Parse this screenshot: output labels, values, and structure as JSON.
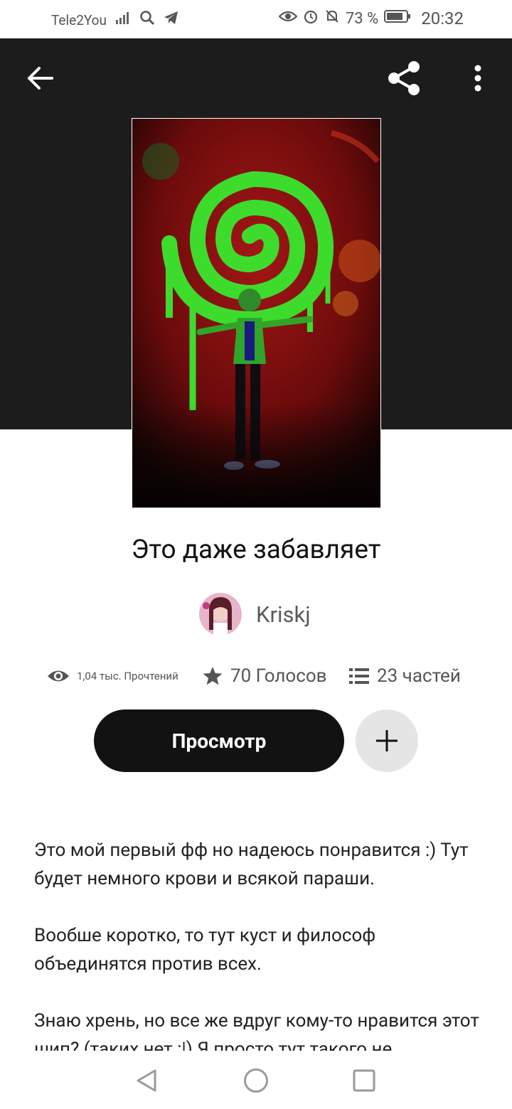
{
  "status_bar": {
    "carrier": "Tele2You",
    "battery": "73 %",
    "time": "20:32",
    "icons": [
      "signal-icon",
      "search-icon",
      "telegram-icon",
      "eye-icon",
      "alarm-icon",
      "bell-off-icon",
      "battery-icon"
    ]
  },
  "story": {
    "title": "Это даже забавляет",
    "author": "Kriskj",
    "reads": "1,04 тыс. Прочтений",
    "votes": "70 Голосов",
    "parts": "23 частей"
  },
  "actions": {
    "read_label": "Просмотр",
    "add_icon": "plus-icon"
  },
  "description": [
    "Это мой первый фф но надеюсь понравится :) Тут будет немного крови и всякой параши.",
    "Вообше коротко, то тут куст и философ объединятся против всех.",
    "Знаю хрень, но все же вдруг кому-то нравится этот шип? (таких нет :|)  Я просто тут такого не"
  ],
  "colors": {
    "header_bg": "#1c1c1c",
    "button_dark": "#121212",
    "button_light": "#e6e5e6",
    "cover_green": "#3ddc2c",
    "cover_red": "#7a0d0d"
  }
}
